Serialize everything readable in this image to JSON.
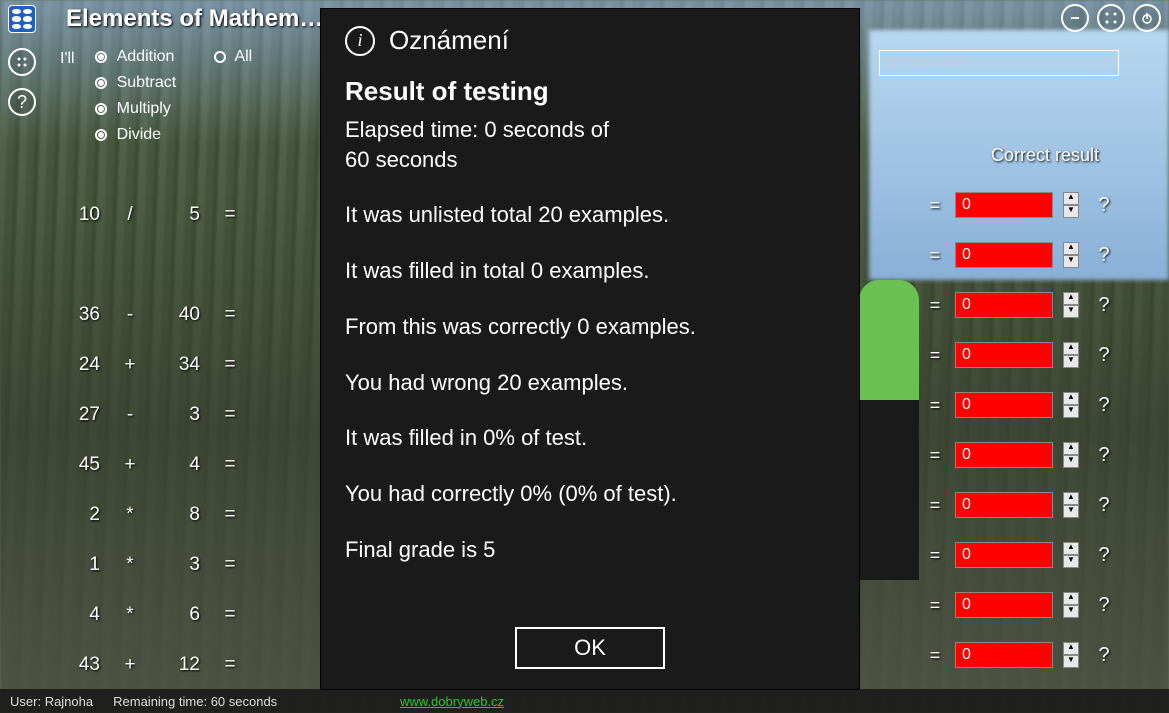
{
  "app": {
    "title": "Elements of Mathem…"
  },
  "timer": {
    "text": "60 seconds"
  },
  "top_controls": {
    "ill": "I'll",
    "all": "All"
  },
  "operations": [
    {
      "label": "Addition",
      "selected": true
    },
    {
      "label": "Subtract",
      "selected": true
    },
    {
      "label": "Multiply",
      "selected": true
    },
    {
      "label": "Divide",
      "selected": true
    }
  ],
  "header": {
    "correct_result": "Correct result"
  },
  "math_rows": [
    {
      "n1": "10",
      "op": "/",
      "n2": "5",
      "eq": "="
    },
    {
      "n1": " ",
      "op": " ",
      "n2": " ",
      "eq": " "
    },
    {
      "n1": "36",
      "op": "-",
      "n2": "40",
      "eq": "="
    },
    {
      "n1": "24",
      "op": "+",
      "n2": "34",
      "eq": "="
    },
    {
      "n1": "27",
      "op": "-",
      "n2": "3",
      "eq": "="
    },
    {
      "n1": "45",
      "op": "+",
      "n2": "4",
      "eq": "="
    },
    {
      "n1": "2",
      "op": "*",
      "n2": "8",
      "eq": "="
    },
    {
      "n1": "1",
      "op": "*",
      "n2": "3",
      "eq": "="
    },
    {
      "n1": "4",
      "op": "*",
      "n2": "6",
      "eq": "="
    },
    {
      "n1": "43",
      "op": "+",
      "n2": "12",
      "eq": "="
    }
  ],
  "results": [
    {
      "value": "0"
    },
    {
      "value": "0"
    },
    {
      "value": "0"
    },
    {
      "value": "0"
    },
    {
      "value": "0"
    },
    {
      "value": "0"
    },
    {
      "value": "0"
    },
    {
      "value": "0"
    },
    {
      "value": "0"
    },
    {
      "value": "0"
    }
  ],
  "qmark": "?",
  "status": {
    "user_label": "User:",
    "user_value": "Rajnoha",
    "remaining_label": "Remaining time:",
    "remaining_value": "60 seconds",
    "link": "www.dobryweb.cz"
  },
  "modal": {
    "title": "Oznámení",
    "heading": "Result of testing",
    "line_elapsed": "Elapsed time: 0 seconds of",
    "line_elapsed2": " 60 seconds",
    "line_unlisted": "It was unlisted total 20 examples.",
    "line_filled": "It was filled in total 0 examples.",
    "line_correct": "From this was correctly 0 examples.",
    "line_wrong": "You had wrong 20 examples.",
    "line_pct_filled": "It was filled in 0% of test.",
    "line_pct_correct": "You had correctly 0% (0% of test).",
    "line_grade": "Final grade is 5",
    "ok": "OK"
  }
}
